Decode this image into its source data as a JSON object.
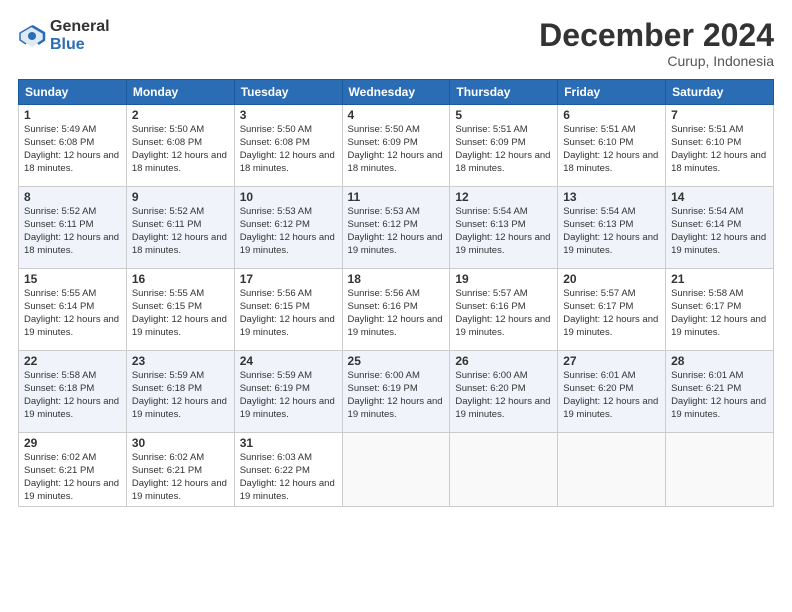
{
  "logo": {
    "general": "General",
    "blue": "Blue"
  },
  "header": {
    "month": "December 2024",
    "location": "Curup, Indonesia"
  },
  "weekdays": [
    "Sunday",
    "Monday",
    "Tuesday",
    "Wednesday",
    "Thursday",
    "Friday",
    "Saturday"
  ],
  "weeks": [
    [
      {
        "day": "1",
        "sunrise": "5:49 AM",
        "sunset": "6:08 PM",
        "daylight": "12 hours and 18 minutes."
      },
      {
        "day": "2",
        "sunrise": "5:50 AM",
        "sunset": "6:08 PM",
        "daylight": "12 hours and 18 minutes."
      },
      {
        "day": "3",
        "sunrise": "5:50 AM",
        "sunset": "6:08 PM",
        "daylight": "12 hours and 18 minutes."
      },
      {
        "day": "4",
        "sunrise": "5:50 AM",
        "sunset": "6:09 PM",
        "daylight": "12 hours and 18 minutes."
      },
      {
        "day": "5",
        "sunrise": "5:51 AM",
        "sunset": "6:09 PM",
        "daylight": "12 hours and 18 minutes."
      },
      {
        "day": "6",
        "sunrise": "5:51 AM",
        "sunset": "6:10 PM",
        "daylight": "12 hours and 18 minutes."
      },
      {
        "day": "7",
        "sunrise": "5:51 AM",
        "sunset": "6:10 PM",
        "daylight": "12 hours and 18 minutes."
      }
    ],
    [
      {
        "day": "8",
        "sunrise": "5:52 AM",
        "sunset": "6:11 PM",
        "daylight": "12 hours and 18 minutes."
      },
      {
        "day": "9",
        "sunrise": "5:52 AM",
        "sunset": "6:11 PM",
        "daylight": "12 hours and 18 minutes."
      },
      {
        "day": "10",
        "sunrise": "5:53 AM",
        "sunset": "6:12 PM",
        "daylight": "12 hours and 19 minutes."
      },
      {
        "day": "11",
        "sunrise": "5:53 AM",
        "sunset": "6:12 PM",
        "daylight": "12 hours and 19 minutes."
      },
      {
        "day": "12",
        "sunrise": "5:54 AM",
        "sunset": "6:13 PM",
        "daylight": "12 hours and 19 minutes."
      },
      {
        "day": "13",
        "sunrise": "5:54 AM",
        "sunset": "6:13 PM",
        "daylight": "12 hours and 19 minutes."
      },
      {
        "day": "14",
        "sunrise": "5:54 AM",
        "sunset": "6:14 PM",
        "daylight": "12 hours and 19 minutes."
      }
    ],
    [
      {
        "day": "15",
        "sunrise": "5:55 AM",
        "sunset": "6:14 PM",
        "daylight": "12 hours and 19 minutes."
      },
      {
        "day": "16",
        "sunrise": "5:55 AM",
        "sunset": "6:15 PM",
        "daylight": "12 hours and 19 minutes."
      },
      {
        "day": "17",
        "sunrise": "5:56 AM",
        "sunset": "6:15 PM",
        "daylight": "12 hours and 19 minutes."
      },
      {
        "day": "18",
        "sunrise": "5:56 AM",
        "sunset": "6:16 PM",
        "daylight": "12 hours and 19 minutes."
      },
      {
        "day": "19",
        "sunrise": "5:57 AM",
        "sunset": "6:16 PM",
        "daylight": "12 hours and 19 minutes."
      },
      {
        "day": "20",
        "sunrise": "5:57 AM",
        "sunset": "6:17 PM",
        "daylight": "12 hours and 19 minutes."
      },
      {
        "day": "21",
        "sunrise": "5:58 AM",
        "sunset": "6:17 PM",
        "daylight": "12 hours and 19 minutes."
      }
    ],
    [
      {
        "day": "22",
        "sunrise": "5:58 AM",
        "sunset": "6:18 PM",
        "daylight": "12 hours and 19 minutes."
      },
      {
        "day": "23",
        "sunrise": "5:59 AM",
        "sunset": "6:18 PM",
        "daylight": "12 hours and 19 minutes."
      },
      {
        "day": "24",
        "sunrise": "5:59 AM",
        "sunset": "6:19 PM",
        "daylight": "12 hours and 19 minutes."
      },
      {
        "day": "25",
        "sunrise": "6:00 AM",
        "sunset": "6:19 PM",
        "daylight": "12 hours and 19 minutes."
      },
      {
        "day": "26",
        "sunrise": "6:00 AM",
        "sunset": "6:20 PM",
        "daylight": "12 hours and 19 minutes."
      },
      {
        "day": "27",
        "sunrise": "6:01 AM",
        "sunset": "6:20 PM",
        "daylight": "12 hours and 19 minutes."
      },
      {
        "day": "28",
        "sunrise": "6:01 AM",
        "sunset": "6:21 PM",
        "daylight": "12 hours and 19 minutes."
      }
    ],
    [
      {
        "day": "29",
        "sunrise": "6:02 AM",
        "sunset": "6:21 PM",
        "daylight": "12 hours and 19 minutes."
      },
      {
        "day": "30",
        "sunrise": "6:02 AM",
        "sunset": "6:21 PM",
        "daylight": "12 hours and 19 minutes."
      },
      {
        "day": "31",
        "sunrise": "6:03 AM",
        "sunset": "6:22 PM",
        "daylight": "12 hours and 19 minutes."
      },
      null,
      null,
      null,
      null
    ]
  ]
}
